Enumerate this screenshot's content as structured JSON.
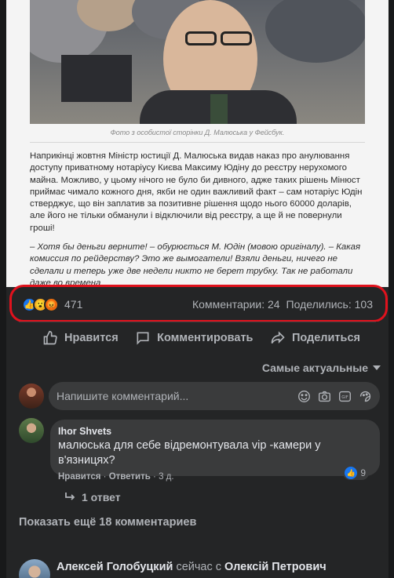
{
  "post": {
    "photo_caption": "Фото з особистої сторінки Д. Малюська у Фейсбук.",
    "article_paragraphs": [
      "Наприкінці жовтня Міністр юстиції Д. Малюська видав наказ про анулювання доступу приватному нотаріусу Києва Максиму Юдіну до реєстру нерухомого майна. Можливо, у цьому нічого не було би дивного, адже таких рішень Мінюст приймає чимало кожного дня, якби не один важливий факт – сам нотаріус Юдін стверджує, що він заплатив за позитивне рішення щодо нього 60000 доларів, але його не тільки обманули і відключили від реєстру, а ще й не повернули гроші!",
      "–   Хотя бы деньги верните! – обурюється М. Юдін (мовою оригіналу). – Какая комиссия по рейдерству? Это же вымогатели! Взяли деньги, ничего не сделали и теперь уже две недели никто не берет трубку. Так не работали даже во времена"
    ]
  },
  "stats": {
    "reaction_count": "471",
    "comments": "Комментарии: 24",
    "shares": "Поделились: 103"
  },
  "actions": {
    "like": "Нравится",
    "comment": "Комментировать",
    "share": "Поделиться"
  },
  "sort_label": "Самые актуальные",
  "comment_input": {
    "placeholder": "Напишите комментарий..."
  },
  "comments": [
    {
      "author": "Ihor Shvets",
      "text": "малюська для себе відремонтувала vip -камери у в'язницях?",
      "like_action": "Нравится",
      "reply_action": "Ответить",
      "time": "3 д.",
      "likes": "9",
      "replies": "1 ответ"
    }
  ],
  "more_comments": "Показать ещё 18 комментариев",
  "next_post": {
    "author": "Алексей Голобуцкий",
    "connector": "сейчас с",
    "with": "Олексій Петрович"
  },
  "colors": {
    "background": "#18191a",
    "card": "#242526",
    "bubble": "#3a3b3c",
    "like_blue": "#1877f2",
    "highlight_red": "#e0121d"
  }
}
